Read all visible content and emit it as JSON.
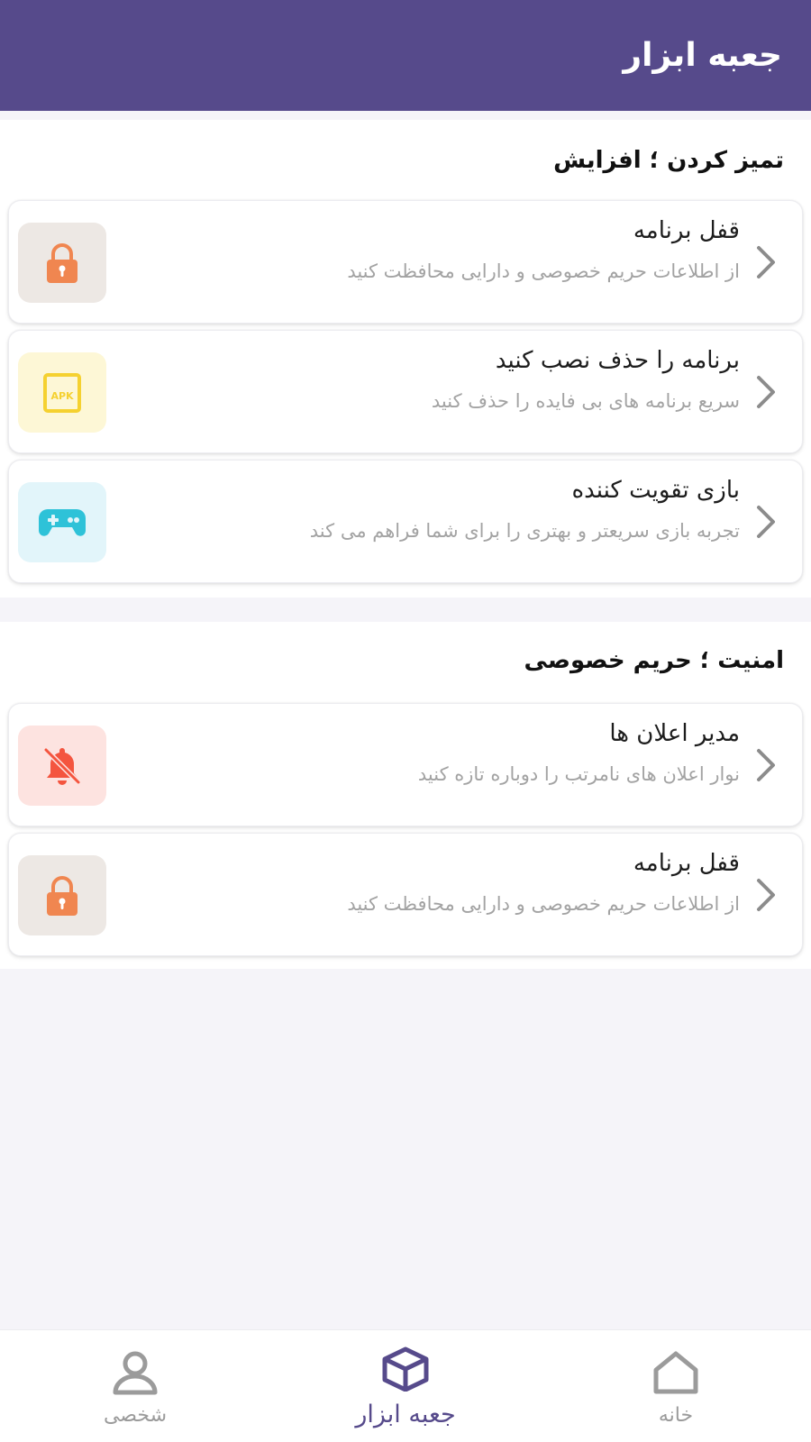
{
  "header": {
    "title": "جعبه ابزار",
    "bg_color": "#564a8b"
  },
  "sections": [
    {
      "title": "تمیز کردن ؛ افزایش",
      "items": [
        {
          "title": "قفل برنامه",
          "subtitle": "از اطلاعات حریم خصوصی و دارایی محافظت کنید",
          "icon": "lock-icon",
          "icon_bg": "#ede8e4",
          "icon_color": "#f08650"
        },
        {
          "title": "برنامه را حذف نصب کنید",
          "subtitle": "سریع برنامه های بی فایده را حذف کنید",
          "icon": "apk-icon",
          "icon_bg": "#fdf7d6",
          "icon_color": "#f5d130",
          "icon_text": "APK"
        },
        {
          "title": "بازی تقویت کننده",
          "subtitle": "تجربه بازی سریعتر و بهتری را برای شما فراهم می کند",
          "icon": "gamepad-icon",
          "icon_bg": "#e2f5fa",
          "icon_color": "#2ec2d8"
        }
      ]
    },
    {
      "title": "امنیت ؛ حریم خصوصی",
      "items": [
        {
          "title": "مدیر اعلان ها",
          "subtitle": "نوار اعلان های نامرتب را دوباره تازه کنید",
          "icon": "bell-off-icon",
          "icon_bg": "#fde3e0",
          "icon_color": "#f4553f"
        },
        {
          "title": "قفل برنامه",
          "subtitle": "از اطلاعات حریم خصوصی و دارایی محافظت کنید",
          "icon": "lock-icon",
          "icon_bg": "#ede8e4",
          "icon_color": "#f08650"
        }
      ]
    }
  ],
  "bottom_nav": {
    "items": [
      {
        "label": "خانه",
        "icon": "home-icon",
        "active": false
      },
      {
        "label": "جعبه ابزار",
        "icon": "box-icon",
        "active": true
      },
      {
        "label": "شخصی",
        "icon": "person-icon",
        "active": false
      }
    ],
    "active_color": "#564a8b",
    "inactive_color": "#9b9b9b"
  }
}
